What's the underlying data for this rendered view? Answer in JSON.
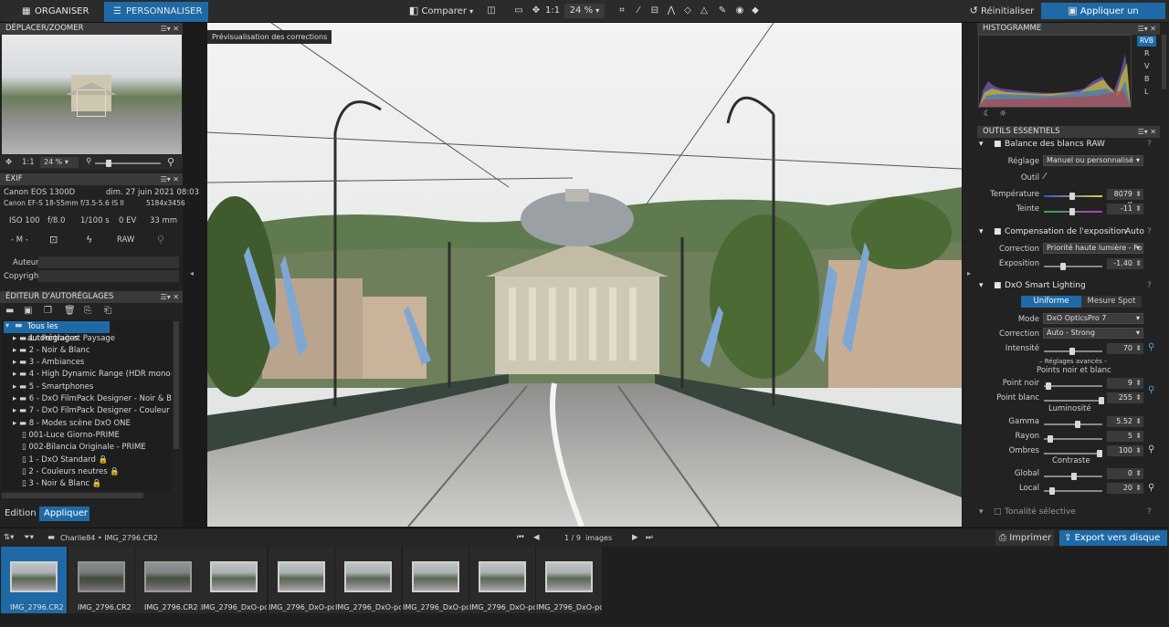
{
  "topbar": {
    "tab_organise": "ORGANISER",
    "tab_personalise": "PERSONNALISER",
    "compare": "Comparer",
    "zoom_1to1": "1:1",
    "zoom": "24 %",
    "reset": "Réinitialiser",
    "apply_preset": "Appliquer un autoréglage"
  },
  "navigator": {
    "title": "DÉPLACER/ZOOMER",
    "zoom_1to1": "1:1",
    "zoom": "24 %"
  },
  "exif": {
    "title": "EXIF",
    "camera": "Canon EOS 1300D",
    "date": "dim. 27 juin 2021 08:03",
    "lens": "Canon EF-S 18-55mm f/3.5-5.6 IS II",
    "size": "5184x3456",
    "iso": "ISO 100",
    "aperture": "f/8.0",
    "shutter": "1/100 s",
    "ev": "0 EV",
    "focal": "33 mm",
    "mode": "- M -",
    "raw": "RAW",
    "author_label": "Auteur",
    "copyright_label": "Copyright"
  },
  "preset_editor": {
    "title": "ÉDITEUR D'AUTORÉGLAGES",
    "root": "Tous les autoréglages",
    "items": [
      "1 - Portrait et Paysage",
      "2 - Noir & Blanc",
      "3 - Ambiances",
      "4 - High Dynamic Range (HDR mono-ima",
      "5 - Smartphones",
      "6 - DxO FilmPack Designer - Noir & Blanc",
      "7 - DxO FilmPack Designer - Couleur",
      "8 - Modes scène DxO ONE",
      "001-Luce Giorno-PRIME",
      "002-Bilancia Originale - PRIME",
      "1 - DxO Standard",
      "2 - Couleurs neutres",
      "3 - Noir & Blanc"
    ],
    "tab_edit": "Edition",
    "tab_apply": "Appliquer"
  },
  "viewer": {
    "tooltip": "Prévisualisation des corrections"
  },
  "histogram": {
    "title": "HISTOGRAMME",
    "channels": [
      "RVB",
      "R",
      "V",
      "B",
      "L"
    ]
  },
  "tools": {
    "title": "OUTILS ESSENTIELS",
    "wb": {
      "title": "Balance des blancs RAW",
      "setting_label": "Réglage",
      "setting_value": "Manuel ou personnalisé",
      "tool_label": "Outil",
      "temp_label": "Température",
      "temp_value": "8079 K",
      "tint_label": "Teinte",
      "tint_value": "-11"
    },
    "exposure": {
      "title": "Compensation de l'exposition",
      "auto": "Auto",
      "correction_label": "Correction",
      "correction_value": "Priorité haute lumière - Fo",
      "exposure_label": "Exposition",
      "exposure_value": "-1.40"
    },
    "smart_lighting": {
      "title": "DxO Smart Lighting",
      "uniform": "Uniforme",
      "spot": "Mesure Spot",
      "mode_label": "Mode",
      "mode_value": "DxO OpticsPro 7",
      "correction_label": "Correction",
      "correction_value": "Auto - Strong",
      "intensity_label": "Intensité",
      "intensity_value": "70",
      "advanced": "– Réglages avancés -",
      "bw_points": "Points noir et blanc",
      "black_label": "Point noir",
      "black_value": "9",
      "white_label": "Point blanc",
      "white_value": "255",
      "luminosity": "Luminosité",
      "gamma_label": "Gamma",
      "gamma_value": "5.52",
      "radius_label": "Rayon",
      "radius_value": "5",
      "shadows_label": "Ombres",
      "shadows_value": "100",
      "contrast": "Contraste",
      "global_label": "Global",
      "global_value": "0",
      "local_label": "Local",
      "local_value": "20"
    },
    "selective_tone": {
      "title": "Tonalité sélective"
    }
  },
  "filmstrip": {
    "breadcrumb_user": "Charlie84",
    "breadcrumb_file": "IMG_2796.CR2",
    "counter": "1 / 9",
    "counter_unit": "images",
    "print": "Imprimer",
    "export": "Export vers disque",
    "thumbs": [
      {
        "name": "IMG_2796.CR2",
        "badge": "1"
      },
      {
        "name": "IMG_2796.CR2",
        "badge": "2"
      },
      {
        "name": "IMG_2796.CR2",
        "badge": "3"
      },
      {
        "name": "IMG_2796_DxO-poi...",
        "badge": ""
      },
      {
        "name": "IMG_2796_DxO-poi...",
        "badge": ""
      },
      {
        "name": "IMG_2796_DxO-poi...",
        "badge": ""
      },
      {
        "name": "IMG_2796_DxO-poi...",
        "badge": ""
      },
      {
        "name": "IMG_2796_DxO-poi...",
        "badge": ""
      },
      {
        "name": "IMG_2796_DxO-poi...",
        "badge": ""
      }
    ]
  },
  "colors": {
    "accent": "#1f6aa6",
    "panel": "#222222",
    "header": "#3a3a3a"
  }
}
